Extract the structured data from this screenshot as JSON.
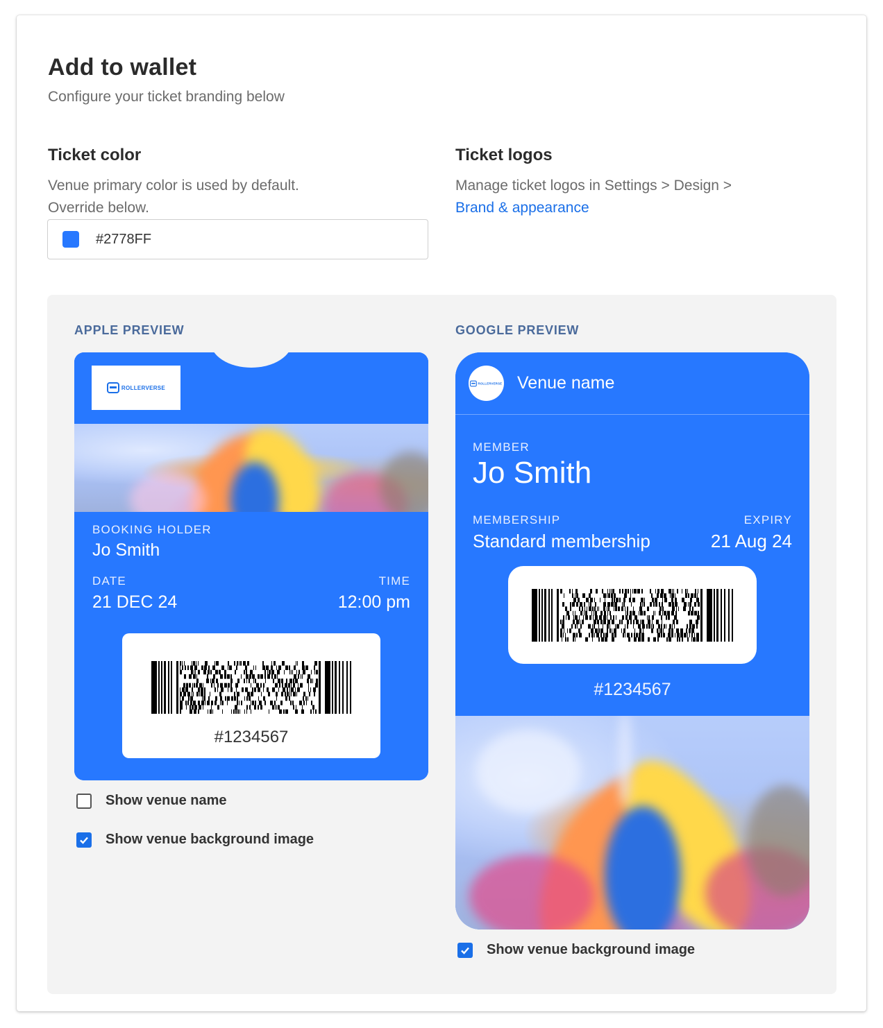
{
  "page": {
    "title": "Add to wallet",
    "subtitle": "Configure your ticket branding below"
  },
  "ticket_color": {
    "heading": "Ticket color",
    "desc_line1": "Venue primary color is used by default.",
    "desc_line2": "Override below.",
    "value": "#2778FF",
    "swatch_color": "#2778FF"
  },
  "ticket_logos": {
    "heading": "Ticket logos",
    "desc": "Manage ticket logos in Settings > Design >",
    "link": "Brand & appearance"
  },
  "apple_preview": {
    "label": "APPLE PREVIEW",
    "logo_text": "ROLLERVERSE",
    "holder_label": "BOOKING HOLDER",
    "holder_value": "Jo Smith",
    "date_label": "DATE",
    "date_value": "21 DEC 24",
    "time_label": "TIME",
    "time_value": "12:00 pm",
    "barcode_number": "#1234567",
    "options": [
      {
        "label": "Show venue name",
        "checked": false
      },
      {
        "label": "Show venue background image",
        "checked": true
      }
    ]
  },
  "google_preview": {
    "label": "GOOGLE PREVIEW",
    "logo_text": "ROLLERVERSE",
    "venue_name": "Venue name",
    "member_label": "MEMBER",
    "member_value": "Jo Smith",
    "membership_label": "MEMBERSHIP",
    "membership_value": "Standard membership",
    "expiry_label": "EXPIRY",
    "expiry_value": "21 Aug 24",
    "barcode_number": "#1234567",
    "options": [
      {
        "label": "Show venue background image",
        "checked": true
      }
    ]
  },
  "colors": {
    "brand": "#2778FF",
    "link": "#1a6fe8",
    "panel_bg": "#f3f3f3"
  }
}
